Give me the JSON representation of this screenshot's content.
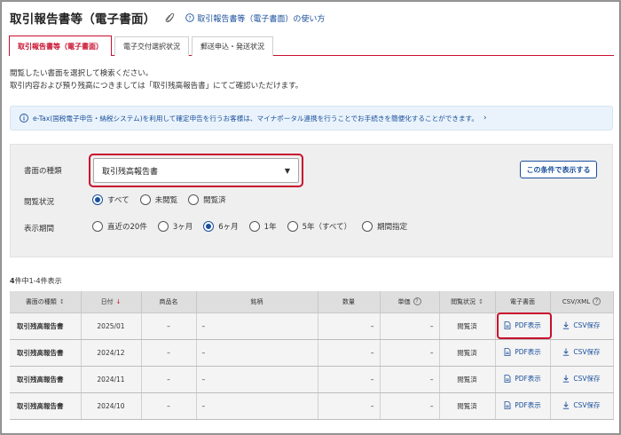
{
  "header": {
    "title": "取引報告書等（電子書面）",
    "help_link": "取引報告書等（電子書面）の使い方"
  },
  "tabs": [
    {
      "label": "取引報告書等（電子書面）",
      "active": true
    },
    {
      "label": "電子交付選択状況",
      "active": false
    },
    {
      "label": "郵送申込・発送状況",
      "active": false
    }
  ],
  "intro": {
    "line1": "閲覧したい書面を選択して検索ください。",
    "line2": "取引内容および預り残高につきましては「取引残高報告書」にてご確認いただけます。"
  },
  "info_banner": {
    "text": "e-Tax(国税電子申告・納税システム)を利用して確定申告を行うお客様は、マイナポータル連携を行うことでお手続きを簡便化することができます。",
    "chevron": "›"
  },
  "search": {
    "doc_type_label": "書面の種類",
    "doc_type_value": "取引残高報告書",
    "search_button": "この条件で表示する",
    "view_status_label": "閲覧状況",
    "view_status_options": [
      {
        "label": "すべて",
        "checked": true
      },
      {
        "label": "未閲覧",
        "checked": false
      },
      {
        "label": "閲覧済",
        "checked": false
      }
    ],
    "period_label": "表示期間",
    "period_options": [
      {
        "label": "直近の20件",
        "checked": false
      },
      {
        "label": "3ヶ月",
        "checked": false
      },
      {
        "label": "6ヶ月",
        "checked": true
      },
      {
        "label": "1年",
        "checked": false
      },
      {
        "label": "5年（すべて）",
        "checked": false
      },
      {
        "label": "期間指定",
        "checked": false
      }
    ]
  },
  "results": {
    "count_bold": "4",
    "count_text": "件中1-4件表示",
    "columns": {
      "doc_type": "書面の種類",
      "date": "日付",
      "product": "商品名",
      "issue": "銘柄",
      "quantity": "数量",
      "price": "単価",
      "status": "閲覧状況",
      "edoc": "電子書面",
      "csv": "CSV/XML"
    },
    "rows": [
      {
        "doc_type": "取引残高報告書",
        "date": "2025/01",
        "product": "–",
        "issue": "–",
        "quantity": "–",
        "price": "–",
        "status": "閲覧済",
        "pdf": "PDF表示",
        "csv": "CSV保存"
      },
      {
        "doc_type": "取引残高報告書",
        "date": "2024/12",
        "product": "–",
        "issue": "–",
        "quantity": "–",
        "price": "–",
        "status": "閲覧済",
        "pdf": "PDF表示",
        "csv": "CSV保存"
      },
      {
        "doc_type": "取引残高報告書",
        "date": "2024/11",
        "product": "–",
        "issue": "–",
        "quantity": "–",
        "price": "–",
        "status": "閲覧済",
        "pdf": "PDF表示",
        "csv": "CSV保存"
      },
      {
        "doc_type": "取引残高報告書",
        "date": "2024/10",
        "product": "–",
        "issue": "–",
        "quantity": "–",
        "price": "–",
        "status": "閲覧済",
        "pdf": "PDF表示",
        "csv": "CSV保存"
      }
    ]
  },
  "colors": {
    "accent_red": "#c8102e",
    "link_blue": "#1a4f9c",
    "banner_bg": "#eaf3fb",
    "panel_bg": "#efefef"
  }
}
